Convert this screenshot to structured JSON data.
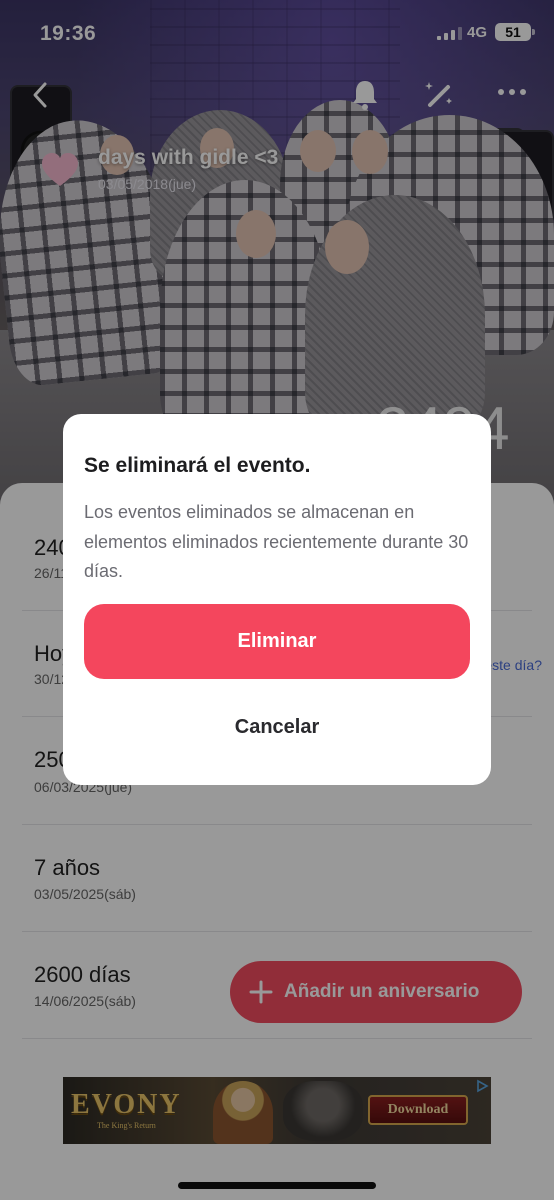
{
  "status_bar": {
    "time": "19:36",
    "network": "4G",
    "battery": "51"
  },
  "hero": {
    "event_title": "days with gidle <3",
    "event_date": "03/05/2018(jue)",
    "day_count": "2494",
    "icons": [
      "back-icon",
      "bell-icon",
      "magic-wand-icon",
      "more-icon",
      "heart-icon"
    ]
  },
  "anniversary_list": [
    {
      "title": "2400 días",
      "date": "26/11/2024(mar)",
      "link": ""
    },
    {
      "title": "Hoy",
      "date": "30/12/2024(lun)",
      "link": "¿Qué pasó este día?"
    },
    {
      "title": "2500 días",
      "date": "06/03/2025(jue)",
      "link": ""
    },
    {
      "title": "7 años",
      "date": "03/05/2025(sáb)",
      "link": ""
    },
    {
      "title": "2600 días",
      "date": "14/06/2025(sáb)",
      "link": ""
    }
  ],
  "fab": {
    "label": "Añadir un aniversario"
  },
  "ad": {
    "brand": "EVONY",
    "tagline": "The King's Return",
    "button": "Download"
  },
  "dialog": {
    "title": "Se eliminará el evento.",
    "body": "Los eventos eliminados se almacenan en elementos eliminados recientemente durante 30 días.",
    "confirm_label": "Eliminar",
    "cancel_label": "Cancelar"
  },
  "colors": {
    "accent": "#f4465d",
    "link": "#4a6bd8"
  }
}
